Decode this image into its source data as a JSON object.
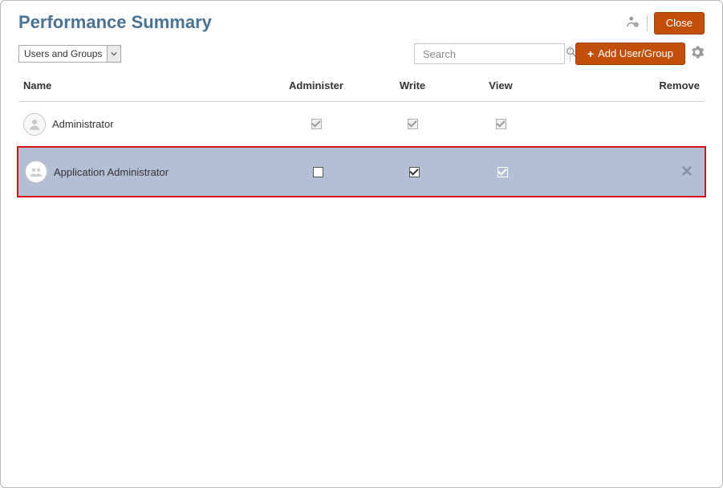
{
  "header": {
    "title": "Performance Summary",
    "close_label": "Close"
  },
  "toolbar": {
    "filter_selected": "Users and Groups",
    "search_placeholder": "Search",
    "add_label": "Add User/Group"
  },
  "grid": {
    "columns": {
      "name": "Name",
      "administer": "Administer",
      "write": "Write",
      "view": "View",
      "remove": "Remove"
    },
    "rows": [
      {
        "name": "Administrator",
        "type": "user",
        "administer": {
          "checked": true,
          "enabled": false
        },
        "write": {
          "checked": true,
          "enabled": false
        },
        "view": {
          "checked": true,
          "enabled": false
        },
        "removable": false,
        "highlighted": false
      },
      {
        "name": "Application Administrator",
        "type": "group",
        "administer": {
          "checked": false,
          "enabled": true
        },
        "write": {
          "checked": true,
          "enabled": true
        },
        "view": {
          "checked": true,
          "enabled": false,
          "light": true
        },
        "removable": true,
        "highlighted": true
      }
    ]
  }
}
